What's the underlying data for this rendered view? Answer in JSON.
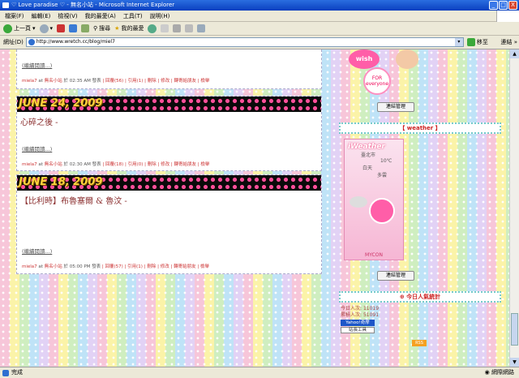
{
  "window": {
    "title": "♡ Love paradise ♡ - 無名小站 - Microsoft Internet Explorer",
    "min": "_",
    "max": "□",
    "close": "X"
  },
  "menu": [
    "檔案(F)",
    "編輯(E)",
    "檢視(V)",
    "我的最愛(A)",
    "工具(T)",
    "說明(H)"
  ],
  "toolbar": {
    "back": "上一頁",
    "search": "搜尋",
    "favorites": "我的最愛"
  },
  "address": {
    "label": "網址(D)",
    "url": "http://www.wretch.cc/blog/miel7",
    "go": "移至",
    "links": "連結 »"
  },
  "posts": [
    {
      "date": "",
      "title": "",
      "readmore": "(繼續閱讀...)",
      "meta": {
        "author": "miela7",
        "at": "at",
        "site": "無名小站",
        "time": "於 02:35 AM 發表",
        "comments": "回覆(56)",
        "trackbacks": "引用(1)",
        "del": "刪除",
        "edit": "修改",
        "share": "轉寄給朋友",
        "report": "檢舉"
      }
    },
    {
      "date": "JUNE 24, 2009",
      "title": "心碎之後 -",
      "readmore": "(繼續閱讀...)",
      "meta": {
        "author": "miela7",
        "at": "at",
        "site": "無名小站",
        "time": "於 02:30 AM 發表",
        "comments": "回覆(18)",
        "trackbacks": "引用(0)",
        "del": "刪除",
        "edit": "修改",
        "share": "轉寄給朋友",
        "report": "檢舉"
      }
    },
    {
      "date": "JUNE 18, 2009",
      "title": "【比利時】布魯塞爾 & 魯汶 -",
      "readmore": "(繼續閱讀...)",
      "meta": {
        "author": "miela7",
        "at": "at",
        "site": "無名小站",
        "time": "於 05:00 PM 發表",
        "comments": "回覆(57)",
        "trackbacks": "引用(1)",
        "del": "刪除",
        "edit": "修改",
        "share": "轉寄給朋友",
        "report": "檢舉"
      }
    }
  ],
  "sidebar": {
    "wish_text": "wish",
    "for_text": "FOR",
    "everyone_text": "everyone",
    "link_manage_1": "連結管理",
    "weather_title": "【 weather 】",
    "weather_widget": {
      "brand": "iWeather",
      "city": "臺北市",
      "temp": "10℃",
      "cond_a": "白天",
      "cond_b": "多雲",
      "footer": "MYCON"
    },
    "link_manage_2": "連結管理",
    "stats_title": "⊕ 今日人氣統計",
    "stats_today_label": "今日人次:",
    "stats_today": "11019",
    "stats_total_label": "累積人次:",
    "stats_total": "51091",
    "yahoo_badge": "Yahoo!奇摩",
    "tool_badge": "站長工具",
    "rss": "RSS"
  },
  "status": {
    "text": "完成",
    "zone": "網際網路"
  },
  "colors": {
    "accent": "#c33",
    "banner_dot": "#ff4f9a",
    "date_text": "#ffd33d"
  }
}
